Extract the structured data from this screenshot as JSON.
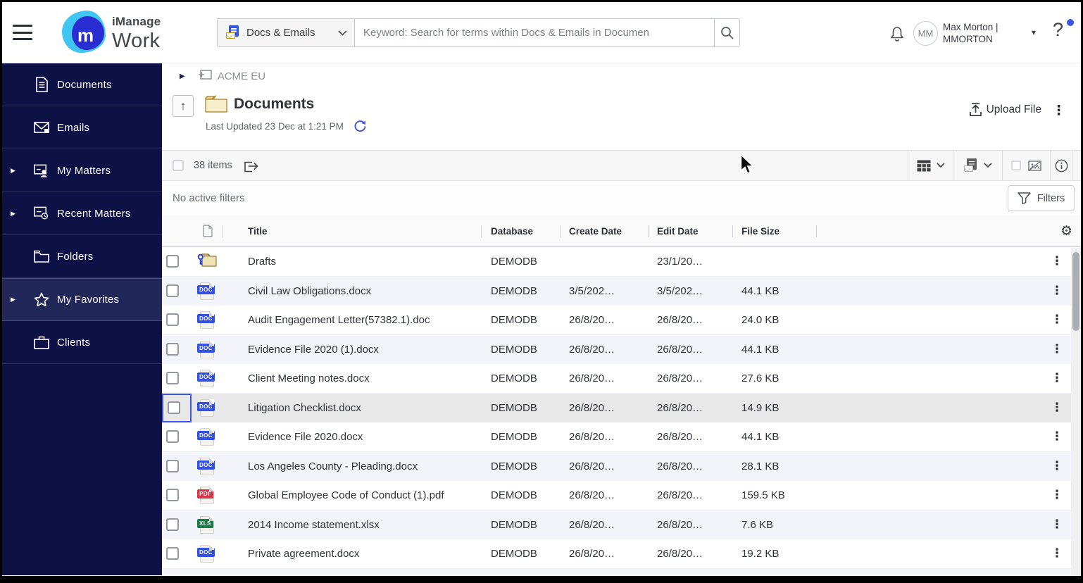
{
  "header": {
    "brand_top": "iManage",
    "brand_bottom": "Work",
    "logo_letter": "m",
    "scope_dropdown": {
      "label": "Docs & Emails"
    },
    "search": {
      "placeholder": "Keyword: Search for terms within Docs & Emails in Documen"
    },
    "user": {
      "initials": "MM",
      "name_line1": "Max Morton |",
      "name_line2": "MMORTON"
    },
    "help_label": "?"
  },
  "sidebar": {
    "items": [
      {
        "label": "Documents",
        "icon": "document-icon",
        "expandable": false,
        "selected": false
      },
      {
        "label": "Emails",
        "icon": "email-icon",
        "expandable": false,
        "selected": false
      },
      {
        "label": "My Matters",
        "icon": "my-matters-icon",
        "expandable": true,
        "selected": false
      },
      {
        "label": "Recent Matters",
        "icon": "recent-matters-icon",
        "expandable": true,
        "selected": false
      },
      {
        "label": "Folders",
        "icon": "folder-icon",
        "expandable": false,
        "selected": false
      },
      {
        "label": "My Favorites",
        "icon": "star-icon",
        "expandable": true,
        "selected": true
      },
      {
        "label": "Clients",
        "icon": "briefcase-icon",
        "expandable": false,
        "selected": false
      }
    ]
  },
  "breadcrumb": {
    "workspace": "ACME EU"
  },
  "page": {
    "title": "Documents",
    "last_updated": "Last Updated 23 Dec at 1:21 PM",
    "upload_label": "Upload File"
  },
  "toolbar": {
    "items_count": "38 items"
  },
  "filters": {
    "status": "No active filters",
    "button_label": "Filters"
  },
  "table": {
    "columns": [
      "Title",
      "Database",
      "Create Date",
      "Edit Date",
      "File Size"
    ],
    "rows": [
      {
        "icon": "folder-key",
        "badge": "",
        "title": "Drafts",
        "database": "DEMODB",
        "create_date": "",
        "edit_date": "23/1/20…",
        "file_size": "",
        "selected": false
      },
      {
        "icon": "file",
        "badge": "DOC",
        "title": "Civil Law Obligations.docx",
        "database": "DEMODB",
        "create_date": "3/5/202…",
        "edit_date": "3/5/202…",
        "file_size": "44.1 KB",
        "selected": false
      },
      {
        "icon": "file",
        "badge": "DOC",
        "title": "Audit Engagement Letter(57382.1).doc",
        "database": "DEMODB",
        "create_date": "26/8/20…",
        "edit_date": "26/8/20…",
        "file_size": "24.0 KB",
        "selected": false
      },
      {
        "icon": "file",
        "badge": "DOC",
        "title": "Evidence File 2020 (1).docx",
        "database": "DEMODB",
        "create_date": "26/8/20…",
        "edit_date": "26/8/20…",
        "file_size": "44.1 KB",
        "selected": false
      },
      {
        "icon": "file",
        "badge": "DOC",
        "title": "Client Meeting notes.docx",
        "database": "DEMODB",
        "create_date": "26/8/20…",
        "edit_date": "26/8/20…",
        "file_size": "27.6 KB",
        "selected": false
      },
      {
        "icon": "file",
        "badge": "DOC",
        "title": "Litigation Checklist.docx",
        "database": "DEMODB",
        "create_date": "26/8/20…",
        "edit_date": "26/8/20…",
        "file_size": "14.9 KB",
        "selected": true
      },
      {
        "icon": "file",
        "badge": "DOC",
        "title": "Evidence File 2020.docx",
        "database": "DEMODB",
        "create_date": "26/8/20…",
        "edit_date": "26/8/20…",
        "file_size": "44.1 KB",
        "selected": false
      },
      {
        "icon": "file",
        "badge": "DOC",
        "title": "Los Angeles County - Pleading.docx",
        "database": "DEMODB",
        "create_date": "26/8/20…",
        "edit_date": "26/8/20…",
        "file_size": "28.1 KB",
        "selected": false
      },
      {
        "icon": "file",
        "badge": "PDF",
        "title": "Global Employee Code of Conduct (1).pdf",
        "database": "DEMODB",
        "create_date": "26/8/20…",
        "edit_date": "26/8/20…",
        "file_size": "159.5 KB",
        "selected": false
      },
      {
        "icon": "file",
        "badge": "XLS",
        "title": "2014 Income statement.xlsx",
        "database": "DEMODB",
        "create_date": "26/8/20…",
        "edit_date": "26/8/20…",
        "file_size": "7.6 KB",
        "selected": false
      },
      {
        "icon": "file",
        "badge": "DOC",
        "title": "Private agreement.docx",
        "database": "DEMODB",
        "create_date": "26/8/20…",
        "edit_date": "26/8/20…",
        "file_size": "19.2 KB",
        "selected": false
      }
    ]
  },
  "icons": {
    "kebab": "⋮",
    "gear": "⚙",
    "up_arrow": "↑",
    "expand_caret": "▶",
    "caret_down": "▾"
  },
  "colors": {
    "sidebar_navy": "#0d1146",
    "accent_blue": "#3b55e6",
    "badge_doc": "#3350e0",
    "badge_pdf": "#d63649",
    "badge_xls": "#1e7a46",
    "stripe": "#f3f3fa",
    "selected_row": "#e8e8e9"
  }
}
